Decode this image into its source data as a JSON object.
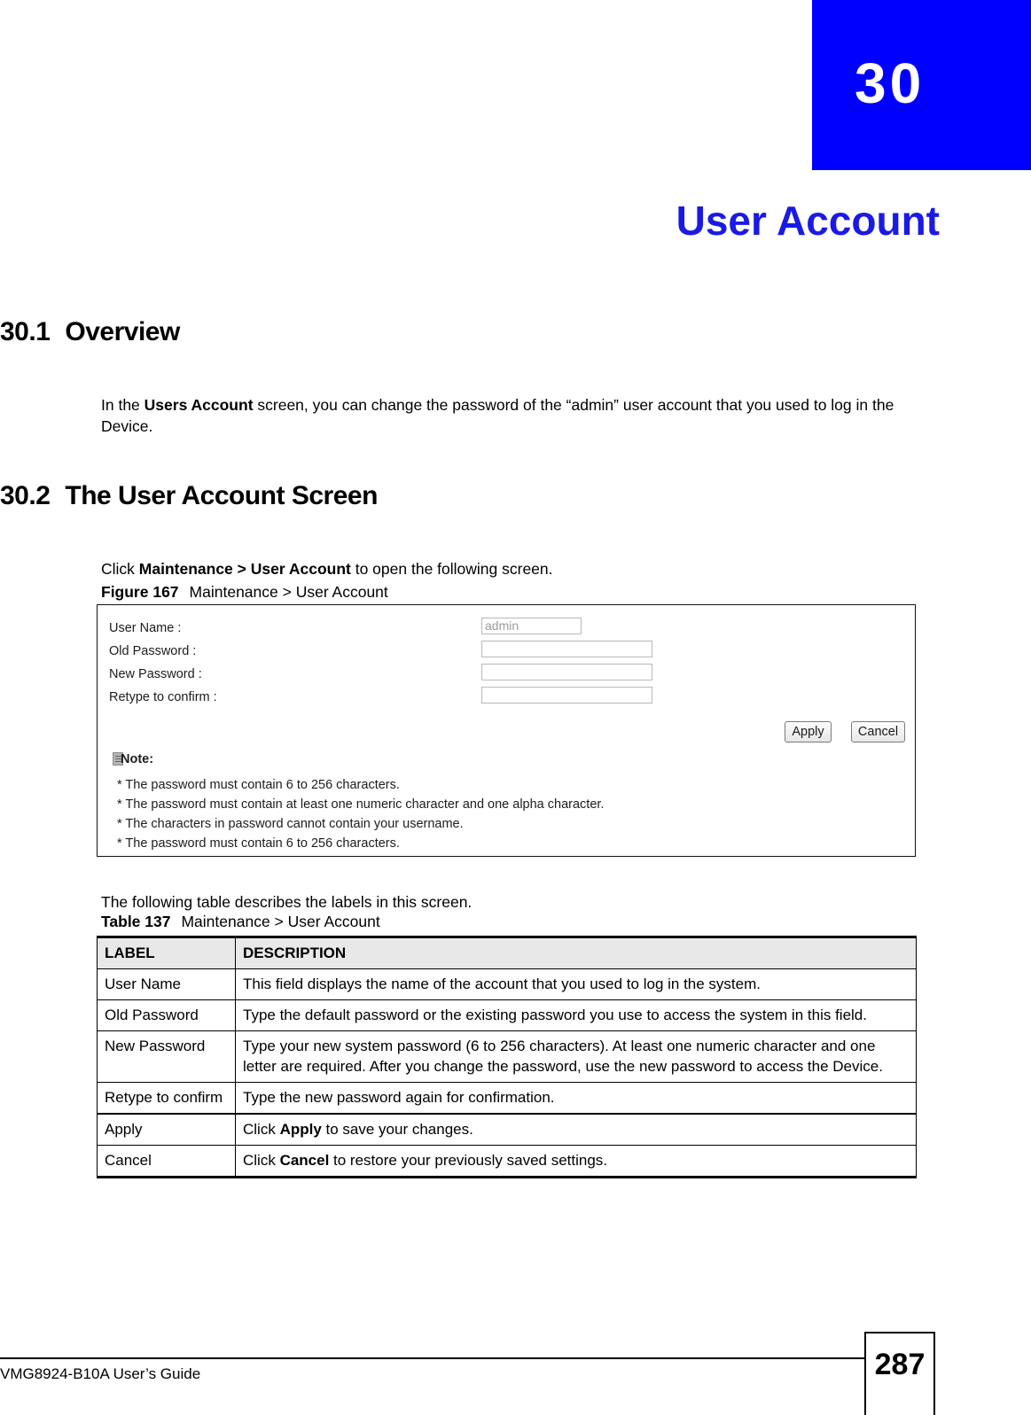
{
  "chapter": {
    "number": "30",
    "title": "User Account"
  },
  "sections": [
    {
      "number": "30.1",
      "heading": "Overview",
      "paragraph_prefix": "In the ",
      "paragraph_bold": "Users Account",
      "paragraph_suffix": " screen, you can change the password of the “admin” user account that you used to log in the Device."
    },
    {
      "number": "30.2",
      "heading": "The User Account Screen",
      "paragraph_prefix": "Click ",
      "paragraph_bold": "Maintenance > User Account",
      "paragraph_suffix": " to open the following screen."
    }
  ],
  "figure": {
    "caption_label": "Figure 167",
    "caption_text": "Maintenance > User Account",
    "form": {
      "rows": [
        {
          "label": "User Name :",
          "value": "admin",
          "type": "readonly"
        },
        {
          "label": "Old Password :",
          "value": "",
          "type": "password"
        },
        {
          "label": "New Password :",
          "value": "",
          "type": "password"
        },
        {
          "label": "Retype to confirm :",
          "value": "",
          "type": "password"
        }
      ],
      "apply_label": "Apply",
      "cancel_label": "Cancel",
      "note_title": "Note:",
      "notes": [
        "* The password must contain 6 to 256 characters.",
        "* The password must contain at least one numeric character and one alpha character.",
        "* The characters in password cannot contain your username.",
        "* The password must contain 6 to 256 characters."
      ]
    }
  },
  "table_intro": "The following table describes the labels in this screen.",
  "table": {
    "caption_label": "Table 137",
    "caption_text": "Maintenance > User Account",
    "headers": [
      "LABEL",
      "DESCRIPTION"
    ],
    "rows": [
      {
        "label": "User Name",
        "description_prefix": "This field displays the name of the account that you used to log in the system.",
        "description_bold": "",
        "description_suffix": ""
      },
      {
        "label": "Old Password",
        "description_prefix": "Type the default password or the existing password you use to access the system in this field.",
        "description_bold": "",
        "description_suffix": ""
      },
      {
        "label": "New Password",
        "description_prefix": "Type your new system password (6 to 256 characters). At least one numeric character and one letter are required.  After you change the password, use the new password to access the Device.",
        "description_bold": "",
        "description_suffix": ""
      },
      {
        "label": "Retype to confirm",
        "description_prefix": "Type the new password again for confirmation.",
        "description_bold": "",
        "description_suffix": ""
      },
      {
        "label": "Apply",
        "description_prefix": "Click ",
        "description_bold": "Apply",
        "description_suffix": " to save your changes."
      },
      {
        "label": "Cancel",
        "description_prefix": "Click ",
        "description_bold": "Cancel",
        "description_suffix": " to restore your previously saved settings."
      }
    ]
  },
  "footer": {
    "guide_title": "VMG8924-B10A User’s Guide",
    "page_number": "287"
  },
  "colors": {
    "chapter_bar": "#0000ff",
    "chapter_title": "#1a1ae6",
    "table_header_bg": "#e8e8e8"
  }
}
